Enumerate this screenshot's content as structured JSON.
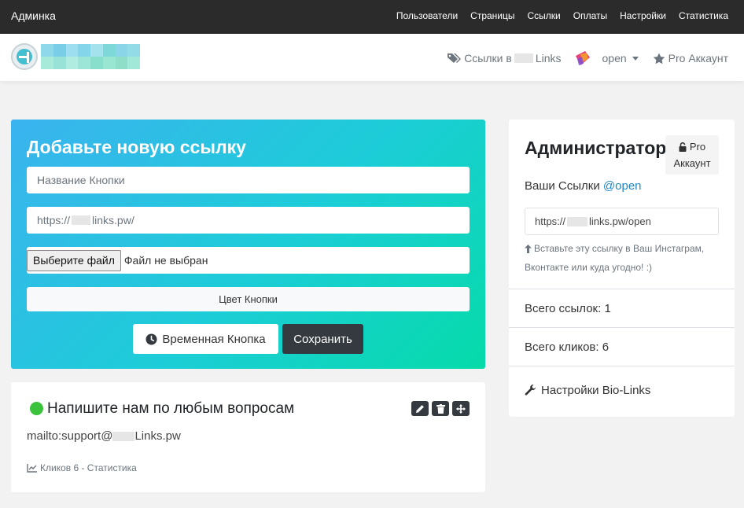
{
  "adminbar": {
    "brand": "Админка",
    "nav": [
      "Пользователи",
      "Страницы",
      "Ссылки",
      "Оплаты",
      "Настройки",
      "Статистика"
    ]
  },
  "header": {
    "links_prefix": "Ссылки в",
    "links_suffix": "Links",
    "user": "open",
    "pro": "Pro Аккаунт"
  },
  "form": {
    "title": "Добавьте новую ссылку",
    "name_placeholder": "Название Кнопки",
    "url_prefix": "https://",
    "url_suffix": "links.pw/",
    "file_button": "Выберите файл",
    "file_status": "Файл не выбран",
    "color_button": "Цвет Кнопки",
    "temp_button": "Временная Кнопка",
    "save_button": "Сохранить"
  },
  "link": {
    "title": "Напишите нам по любым вопросам",
    "url_prefix": "mailto:support@",
    "url_suffix": "Links.pw",
    "stats": "Кликов 6 - Статистика",
    "status_color": "#3cc23c"
  },
  "sidebar": {
    "title": "Администратор",
    "pro_line1": "Pro",
    "pro_line2": "Аккаунт",
    "your_links": "Ваши Ссылки",
    "handle": "@open",
    "url_prefix": "https://",
    "url_suffix": "links.pw/open",
    "hint": "Вставьте эту ссылку в Ваш Инстаграм, Вконтакте или куда угодно! :)",
    "total_links": "Всего ссылок: 1",
    "total_clicks": "Всего кликов: 6",
    "settings": "Настройки Bio-Links"
  },
  "colors": {
    "accent_link": "#1e88c7",
    "dark": "#343a40",
    "gradient_start": "#3bb3ef",
    "gradient_end": "#05dba9"
  }
}
